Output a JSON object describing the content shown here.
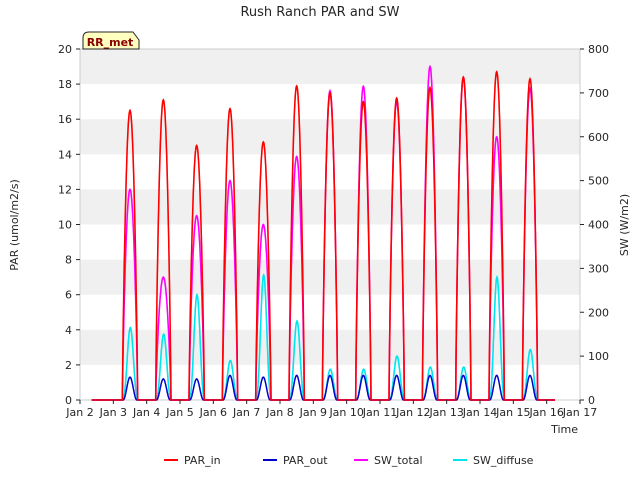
{
  "chart_data": {
    "type": "line",
    "title": "Rush Ranch PAR and SW",
    "xlabel": "Time",
    "ylabel_left": "PAR (umol/m2/s)",
    "ylabel_right": "SW (W/m2)",
    "site_badge": "RR_met",
    "ylim_left": [
      0,
      20
    ],
    "ylim_right": [
      0,
      800
    ],
    "xlim": [
      2,
      17
    ],
    "x_ticks": [
      2,
      3,
      4,
      5,
      6,
      7,
      8,
      9,
      10,
      11,
      12,
      13,
      14,
      15,
      16,
      17
    ],
    "x_tick_labels": [
      "Jan 2",
      "Jan 3",
      "Jan 4",
      "Jan 5",
      "Jan 6",
      "Jan 7",
      "Jan 8",
      "Jan 9",
      "Jan 10",
      "Jan 11",
      "Jan 12",
      "Jan 13",
      "Jan 14",
      "Jan 15",
      "Jan 16",
      "Jan 17"
    ],
    "y_ticks_left": [
      0,
      2,
      4,
      6,
      8,
      10,
      12,
      14,
      16,
      18,
      20
    ],
    "y_ticks_right": [
      0,
      100,
      200,
      300,
      400,
      500,
      600,
      700,
      800
    ],
    "grid": "horizontal bands",
    "legend_placement": "bottom",
    "days": [
      3,
      4,
      5,
      6,
      7,
      8,
      9,
      10,
      11,
      12,
      13,
      14,
      15,
      16
    ],
    "series": [
      {
        "name": "PAR_in",
        "color": "#ff0000",
        "axis": "left",
        "day_peaks": [
          16.5,
          17.1,
          14.5,
          16.6,
          14.7,
          17.9,
          17.5,
          17.0,
          17.2,
          17.8,
          18.4,
          18.7,
          18.3,
          18.4
        ]
      },
      {
        "name": "PAR_out",
        "color": "#0000cc",
        "axis": "left",
        "day_peaks": [
          1.3,
          1.2,
          1.2,
          1.4,
          1.3,
          1.4,
          1.4,
          1.4,
          1.4,
          1.4,
          1.4,
          1.4,
          1.4,
          1.5
        ]
      },
      {
        "name": "SW_total",
        "color": "#ff00ff",
        "axis": "right",
        "day_peaks": [
          480,
          280,
          420,
          500,
          400,
          555,
          705,
          715,
          680,
          760,
          735,
          600,
          710,
          725
        ]
      },
      {
        "name": "SW_diffuse",
        "color": "#00e5ee",
        "axis": "right",
        "day_peaks": [
          165,
          150,
          240,
          90,
          285,
          180,
          70,
          70,
          100,
          75,
          75,
          280,
          115,
          95
        ]
      }
    ]
  }
}
